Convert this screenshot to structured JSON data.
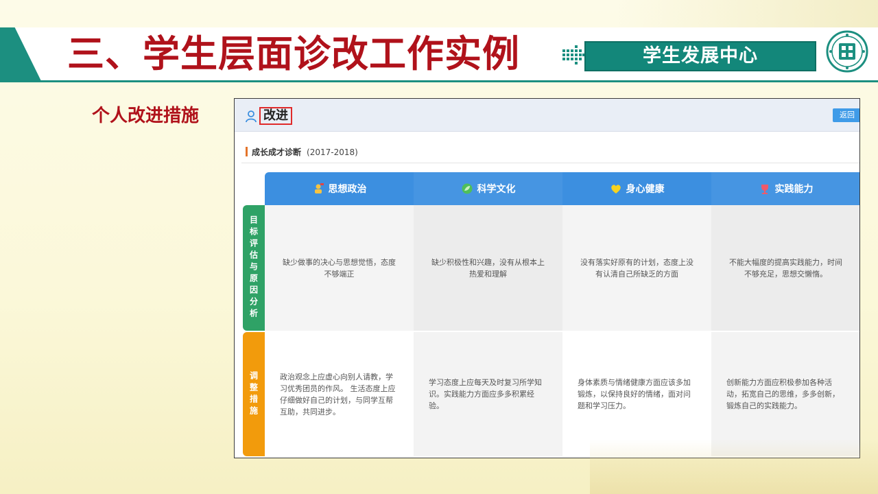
{
  "slide": {
    "title": "三、学生层面诊改工作实例",
    "center_name": "学生发展中心",
    "section_label": "个人改进措施"
  },
  "screen": {
    "page_title": "改进",
    "back_label": "返回",
    "diagnosis_label": "成长成才诊断",
    "diagnosis_year": "(2017-2018)",
    "columns": [
      {
        "label": "思想政治",
        "icon": "person-flag-icon"
      },
      {
        "label": "科学文化",
        "icon": "leaf-icon"
      },
      {
        "label": "身心健康",
        "icon": "heart-icon"
      },
      {
        "label": "实践能力",
        "icon": "trophy-icon"
      }
    ],
    "rows": [
      {
        "label": "目标评估与原因分析",
        "cells": [
          "缺少做事的决心与思想觉悟，态度不够端正",
          "缺少积极性和兴趣，没有从根本上热爱和理解",
          "没有落实好原有的计划，态度上没有认清自己所缺乏的方面",
          "不能大幅度的提高实践能力，时间不够充足，思想交懒惰。"
        ]
      },
      {
        "label": "调整措施",
        "cells": [
          "政治观念上应虚心向别人请教，学习优秀团员的作风。 生活态度上应仔细做好自己的计划，与同学互帮互助，共同进步。",
          "学习态度上应每天及时复习所学知识。实践能力方面应多多积累经验。",
          "身体素质与情绪健康方面应该多加锻炼，以保持良好的情绪，面对问题和学习压力。",
          "创新能力方面应积极参加各种活动，拓宽自己的思维，多多创新，锻炼自己的实践能力。"
        ]
      }
    ]
  },
  "colors": {
    "title_red": "#b0121b",
    "teal": "#1c8f80",
    "header_blue": "#3c8fe0",
    "row_green": "#2fa266",
    "row_orange": "#f29b0c",
    "highlight_red": "#e02a2a"
  }
}
